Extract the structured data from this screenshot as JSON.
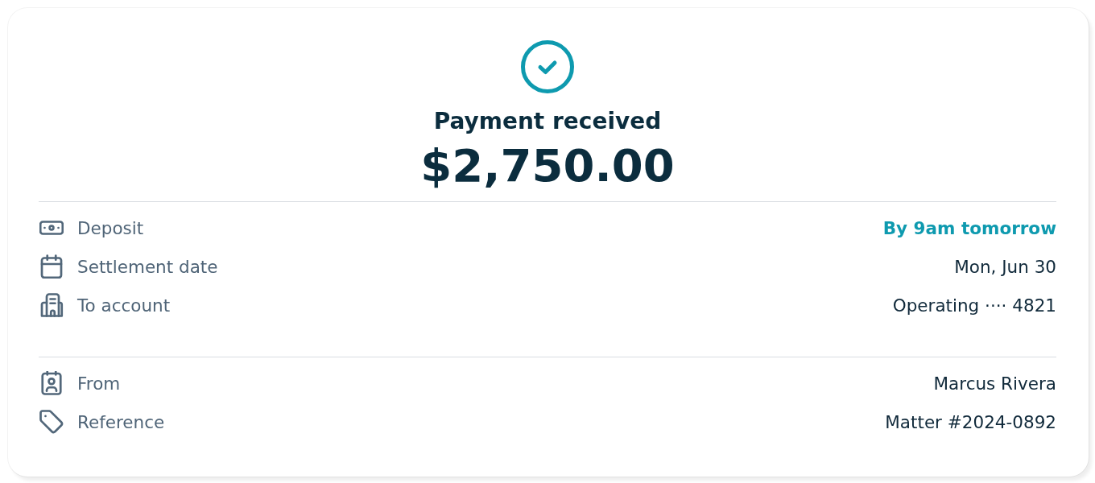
{
  "header": {
    "title": "Payment received",
    "amount": "$2,750.00"
  },
  "sections": [
    {
      "rows": [
        {
          "label": "Deposit",
          "value": "By 9am tomorrow",
          "highlighted": true
        },
        {
          "label": "Settlement date",
          "value": "Mon, Jun 30",
          "highlighted": false
        },
        {
          "label": "To account",
          "value": "Operating ···· 4821",
          "highlighted": false
        }
      ]
    },
    {
      "rows": [
        {
          "label": "From",
          "value": "Marcus Rivera",
          "highlighted": false
        },
        {
          "label": "Reference",
          "value": "Matter #2024-0892",
          "highlighted": false
        }
      ]
    }
  ]
}
